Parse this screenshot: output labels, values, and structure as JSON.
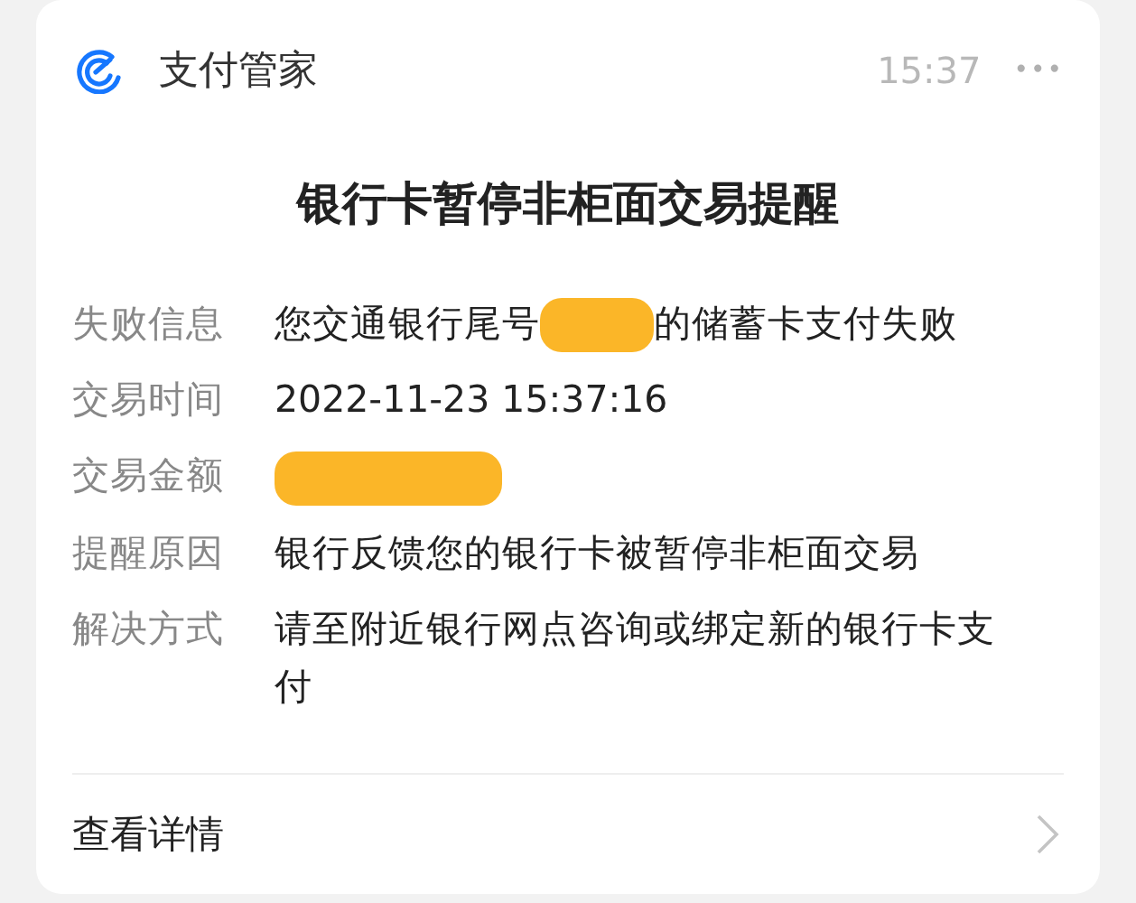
{
  "header": {
    "app_name": "支付管家",
    "time": "15:37",
    "menu": "•••"
  },
  "title": "银行卡暂停非柜面交易提醒",
  "rows": [
    {
      "label": "失败信息",
      "segments": [
        {
          "kind": "text",
          "text": "您交通银行尾号"
        },
        {
          "kind": "redaction"
        },
        {
          "kind": "text",
          "text": "的储蓄卡支付失败"
        }
      ]
    },
    {
      "label": "交易时间",
      "segments": [
        {
          "kind": "text",
          "text": "2022-11-23 15:37:16"
        }
      ]
    },
    {
      "label": "交易金额",
      "segments": [
        {
          "kind": "redaction"
        }
      ]
    },
    {
      "label": "提醒原因",
      "segments": [
        {
          "kind": "text",
          "text": "银行反馈您的银行卡被暂停非柜面交易"
        }
      ]
    },
    {
      "label": "解决方式",
      "segments": [
        {
          "kind": "text",
          "text": "请至附近银行网点咨询或绑定新的银行卡支付"
        }
      ]
    }
  ],
  "footer": {
    "link": "查看详情"
  }
}
